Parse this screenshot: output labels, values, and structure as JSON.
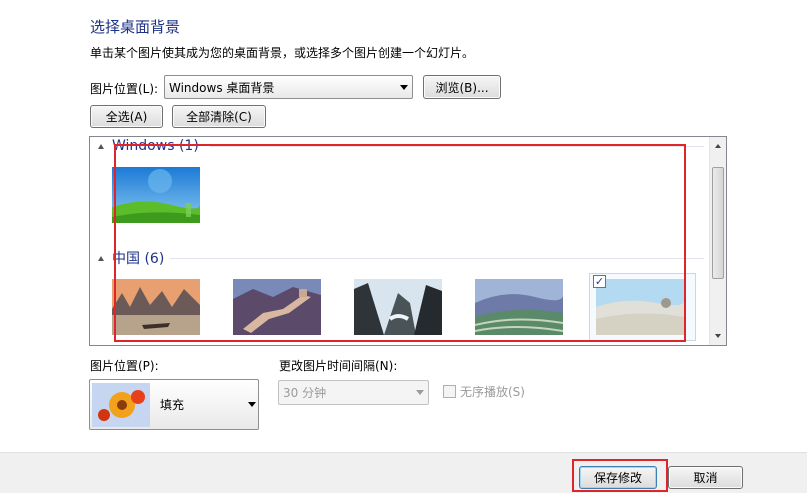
{
  "header": {
    "title": "选择桌面背景",
    "description": "单击某个图片使其成为您的桌面背景，或选择多个图片创建一个幻灯片。"
  },
  "location": {
    "label": "图片位置(L):",
    "selected": "Windows 桌面背景",
    "browse_label": "浏览(B)..."
  },
  "selection": {
    "select_all_label": "全选(A)",
    "clear_all_label": "全部清除(C)"
  },
  "groups": [
    {
      "title": "Windows (1)",
      "images": [
        {
          "icon": "windows-landscape-wallpaper",
          "checked": false
        }
      ]
    },
    {
      "title": "中国 (6)",
      "images": [
        {
          "icon": "karst-mountains-river-wallpaper",
          "checked": false
        },
        {
          "icon": "great-wall-wallpaper",
          "checked": false
        },
        {
          "icon": "huangshan-mountains-wallpaper",
          "checked": false
        },
        {
          "icon": "rice-terraces-wallpaper",
          "checked": false
        },
        {
          "icon": "desert-dunes-wallpaper",
          "checked": true
        }
      ]
    }
  ],
  "position": {
    "label": "图片位置(P):",
    "selected": "填充"
  },
  "interval": {
    "label": "更改图片时间间隔(N):",
    "selected": "30 分钟",
    "enabled": false
  },
  "shuffle": {
    "label": "无序播放(S)",
    "checked": false,
    "enabled": false
  },
  "footer": {
    "save_label": "保存修改",
    "cancel_label": "取消"
  },
  "colors": {
    "title": "#1e3287",
    "highlight": "#e0242a"
  }
}
